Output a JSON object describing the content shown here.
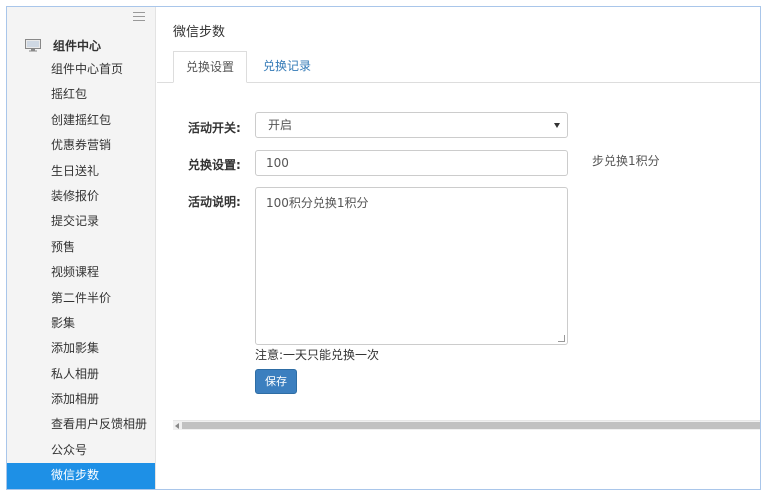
{
  "sidebar": {
    "section_title": "组件中心",
    "section_icon": "monitor-icon",
    "items": [
      {
        "label": "组件中心首页"
      },
      {
        "label": "摇红包"
      },
      {
        "label": "创建摇红包"
      },
      {
        "label": "优惠券营销"
      },
      {
        "label": "生日送礼"
      },
      {
        "label": "装修报价"
      },
      {
        "label": "提交记录"
      },
      {
        "label": "预售"
      },
      {
        "label": "视频课程"
      },
      {
        "label": "第二件半价"
      },
      {
        "label": "影集"
      },
      {
        "label": "添加影集"
      },
      {
        "label": "私人相册"
      },
      {
        "label": "添加相册"
      },
      {
        "label": "查看用户反馈相册"
      },
      {
        "label": "公众号"
      },
      {
        "label": "微信步数"
      }
    ],
    "active_index": 16
  },
  "page": {
    "title": "微信步数",
    "tabs": [
      {
        "label": "兑换设置"
      },
      {
        "label": "兑换记录"
      }
    ]
  },
  "form": {
    "switch_label": "活动开关:",
    "switch_value": "开启",
    "exchange_label": "兑换设置:",
    "exchange_value": "100",
    "exchange_suffix": "步兑换1积分",
    "desc_label": "活动说明:",
    "desc_value": "100积分兑换1积分",
    "note": "注意:一天只能兑换一次",
    "save_label": "保存"
  },
  "colors": {
    "active_nav": "#1e90e6",
    "save_button": "#3c7fbf",
    "tab_link": "#337ab7"
  }
}
